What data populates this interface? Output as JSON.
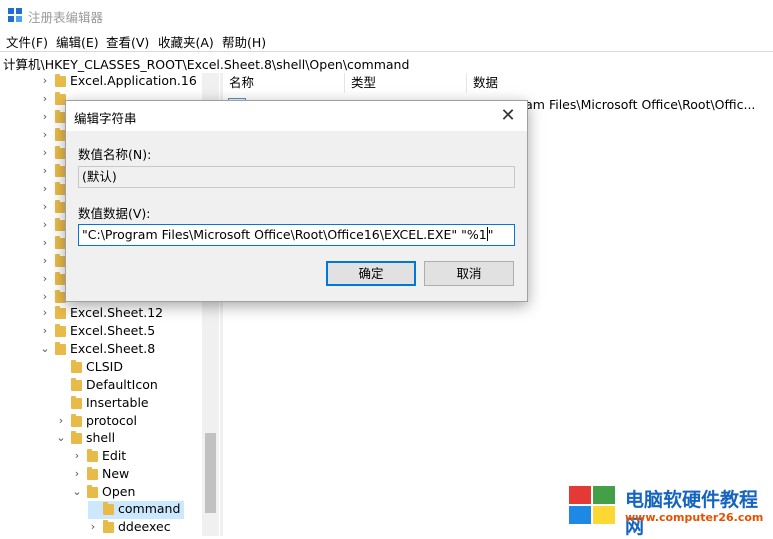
{
  "window": {
    "title": "注册表编辑器"
  },
  "menu": [
    "文件(F)",
    "编辑(E)",
    "查看(V)",
    "收藏夹(A)",
    "帮助(H)"
  ],
  "address": "计算机\\HKEY_CLASSES_ROOT\\Excel.Sheet.8\\shell\\Open\\command",
  "tree": [
    {
      "label": "Excel.Application.16",
      "chevron": "›"
    },
    {
      "label": "Excel.Sheet.12",
      "chevron": "›"
    },
    {
      "label": "Excel.Sheet.5",
      "chevron": "›"
    },
    {
      "label": "Excel.Sheet.8",
      "chevron": "⌄"
    },
    {
      "label": "CLSID",
      "chevron": ""
    },
    {
      "label": "DefaultIcon",
      "chevron": ""
    },
    {
      "label": "Insertable",
      "chevron": ""
    },
    {
      "label": "protocol",
      "chevron": "›"
    },
    {
      "label": "shell",
      "chevron": "⌄"
    },
    {
      "label": "Edit",
      "chevron": "›"
    },
    {
      "label": "New",
      "chevron": "›"
    },
    {
      "label": "Open",
      "chevron": "⌄"
    },
    {
      "label": "command",
      "chevron": ""
    },
    {
      "label": "ddeexec",
      "chevron": "›"
    }
  ],
  "list": {
    "columns": [
      "名称",
      "类型",
      "数据"
    ],
    "rows": [
      {
        "data": "ram Files\\Microsoft Office\\Root\\Offic..."
      }
    ]
  },
  "dialog": {
    "title": "编辑字符串",
    "name_label": "数值名称(N):",
    "name_value": "(默认)",
    "data_label": "数值数据(V):",
    "data_value": "\"C:\\Program Files\\Microsoft Office\\Root\\Office16\\EXCEL.EXE\" \"%1",
    "data_value_tail": "\"",
    "ok_label": "确定",
    "cancel_label": "取消",
    "close_glyph": "✕"
  },
  "watermark": {
    "title": "电脑软硬件教程网",
    "url": "www.computer26.com"
  },
  "colors": {
    "accent": "#0078d7",
    "folder": "#e8bb49",
    "selection": "#cce8ff"
  }
}
